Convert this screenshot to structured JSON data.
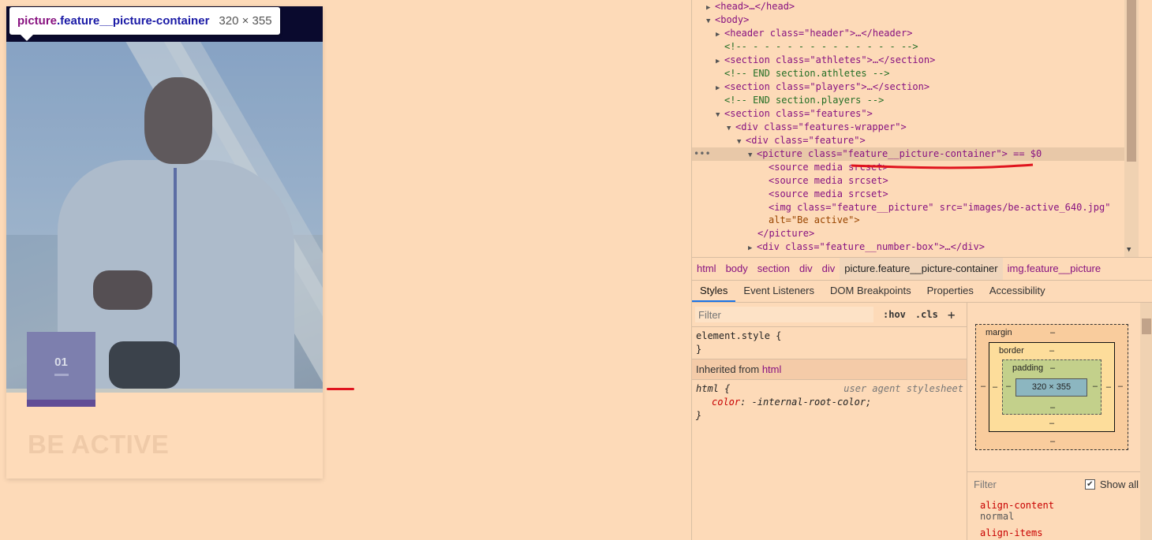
{
  "tooltip": {
    "tag": "picture",
    "class_name": ".feature__picture-container",
    "dimensions": "320 × 355"
  },
  "feature": {
    "number": "01",
    "title": "BE ACTIVE"
  },
  "elements": [
    {
      "text": "<head>…</head>"
    },
    {
      "text": "<body>"
    },
    {
      "text": "<header class=\"header\">…</header>"
    },
    {
      "text": "<!--  - - - - - - - - - - - - - -->"
    },
    {
      "text": "<section class=\"athletes\">…</section>"
    },
    {
      "text": "<!-- END section.athletes -->"
    },
    {
      "text": "<section class=\"players\">…</section>"
    },
    {
      "text": "<!-- END section.players  -->"
    },
    {
      "text": "<section class=\"features\">"
    },
    {
      "text": "<div class=\"features-wrapper\">"
    },
    {
      "text": "<div class=\"feature\">"
    },
    {
      "text": "<picture class=\"feature__picture-container\"> == $0"
    },
    {
      "text": "<source media srcset>"
    },
    {
      "text": "<source media srcset>"
    },
    {
      "text": "<source media srcset>"
    },
    {
      "text": "<img class=\"feature__picture\" src=\"images/be-active_640.jpg\""
    },
    {
      "text": "alt=\"Be active\">"
    },
    {
      "text": "</picture>"
    },
    {
      "text": "<div class=\"feature__number-box\">…</div>"
    }
  ],
  "breadcrumbs": [
    "html",
    "body",
    "section",
    "div",
    "div",
    "picture.feature__picture-container",
    "img.feature__picture"
  ],
  "tabs": [
    "Styles",
    "Event Listeners",
    "DOM Breakpoints",
    "Properties",
    "Accessibility"
  ],
  "styles": {
    "filter_placeholder": "Filter",
    "hov": ":hov",
    "cls": ".cls",
    "element_style": "element.style {",
    "close_brace": "}",
    "inherited_from_label": "Inherited from",
    "inherited_from_tag": "html",
    "ua_selector": "html {",
    "ua_source": "user agent stylesheet",
    "ua_prop": "color",
    "ua_value": "-internal-root-color;"
  },
  "box_model": {
    "margin_label": "margin",
    "border_label": "border",
    "padding_label": "padding",
    "content": "320 × 355",
    "dash": "–"
  },
  "computed": {
    "filter_placeholder": "Filter",
    "show_all": "Show all",
    "props": [
      {
        "name": "align-content",
        "value": "normal"
      },
      {
        "name": "align-items",
        "value": ""
      }
    ]
  }
}
